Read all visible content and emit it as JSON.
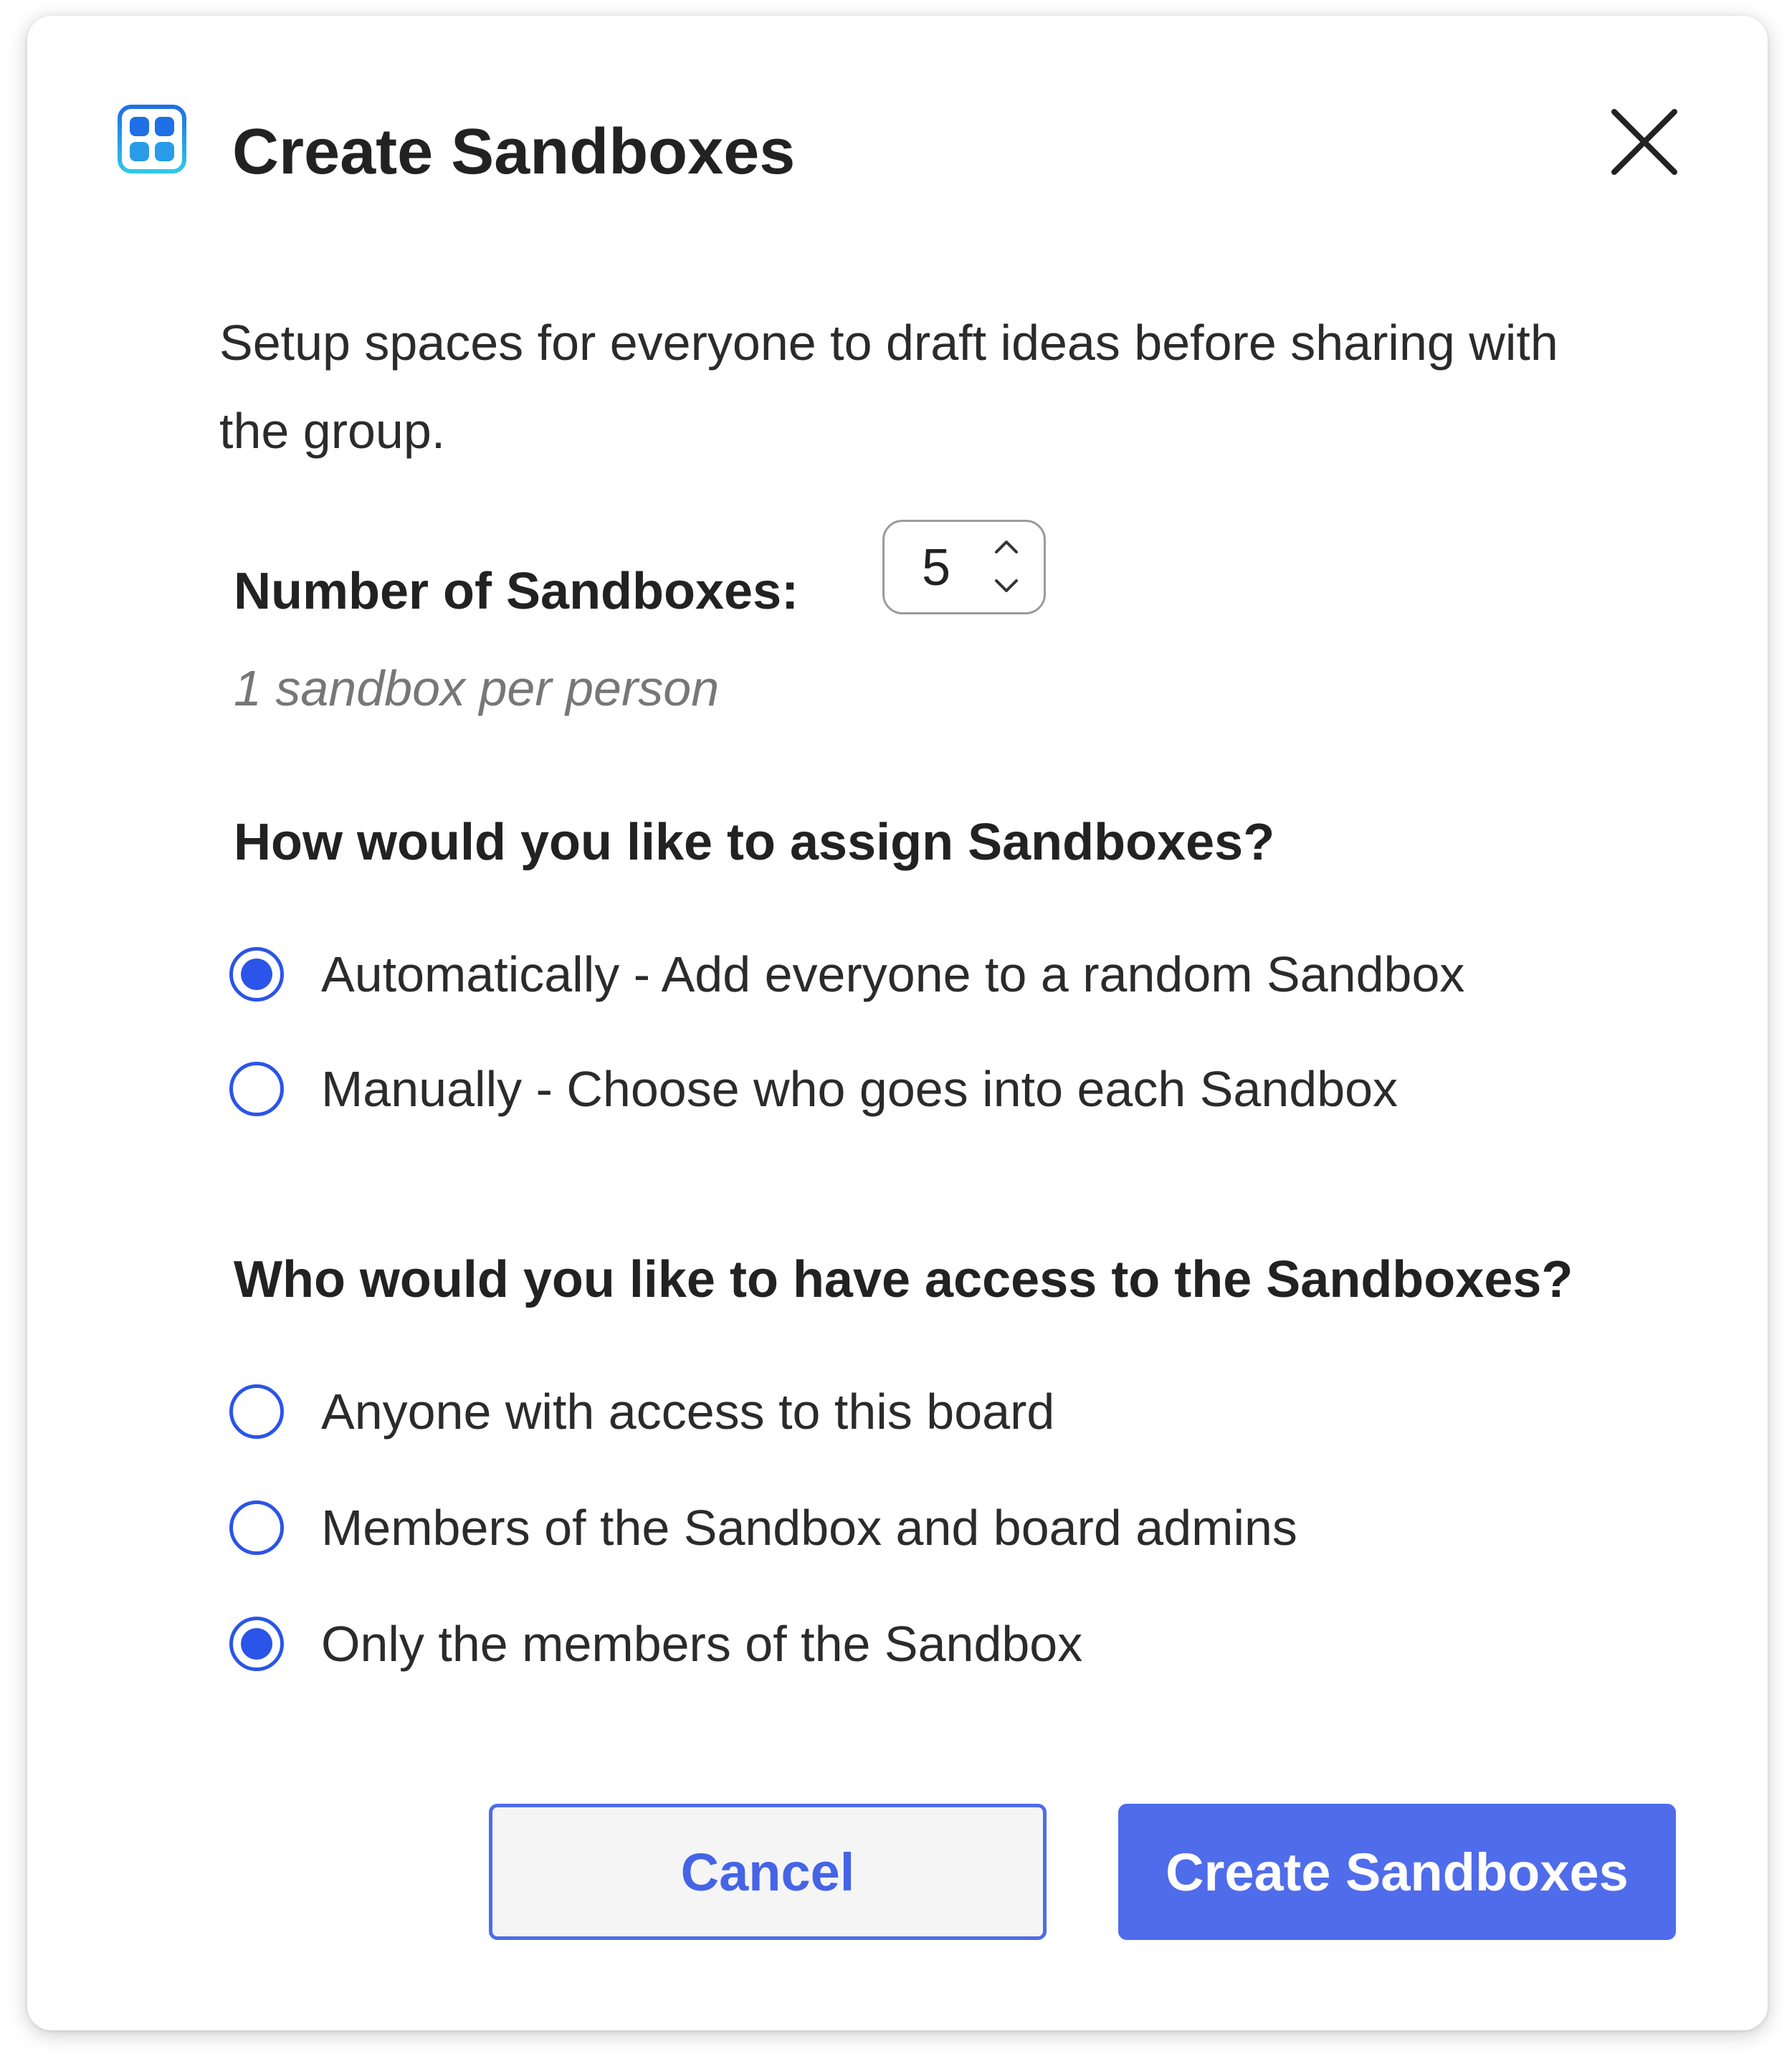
{
  "dialog": {
    "title": "Create Sandboxes",
    "description": "Setup spaces for everyone to draft ideas before sharing with the group.",
    "icons": {
      "app": "sandbox-grid-icon",
      "close": "close-icon",
      "stepper_up": "chevron-up-icon",
      "stepper_down": "chevron-down-icon"
    }
  },
  "count": {
    "label": "Number of Sandboxes:",
    "value": "5",
    "hint": "1 sandbox per person"
  },
  "assign": {
    "heading": "How would you like to assign Sandboxes?",
    "options": [
      {
        "label": "Automatically - Add everyone to a random Sandbox",
        "selected": true
      },
      {
        "label": "Manually - Choose who goes into each Sandbox",
        "selected": false
      }
    ]
  },
  "access": {
    "heading": "Who would you like to have access to the Sandboxes?",
    "options": [
      {
        "label": "Anyone with access to this board",
        "selected": false
      },
      {
        "label": "Members of the Sandbox and board admins",
        "selected": false
      },
      {
        "label": "Only the members of the Sandbox",
        "selected": true
      }
    ]
  },
  "actions": {
    "cancel_label": "Cancel",
    "create_label": "Create Sandboxes"
  },
  "colors": {
    "accent": "#2b54e8",
    "primary_button": "#4f6ceb",
    "icon_gradient_start": "#1f6fe6",
    "icon_gradient_end": "#2fc7e8"
  }
}
